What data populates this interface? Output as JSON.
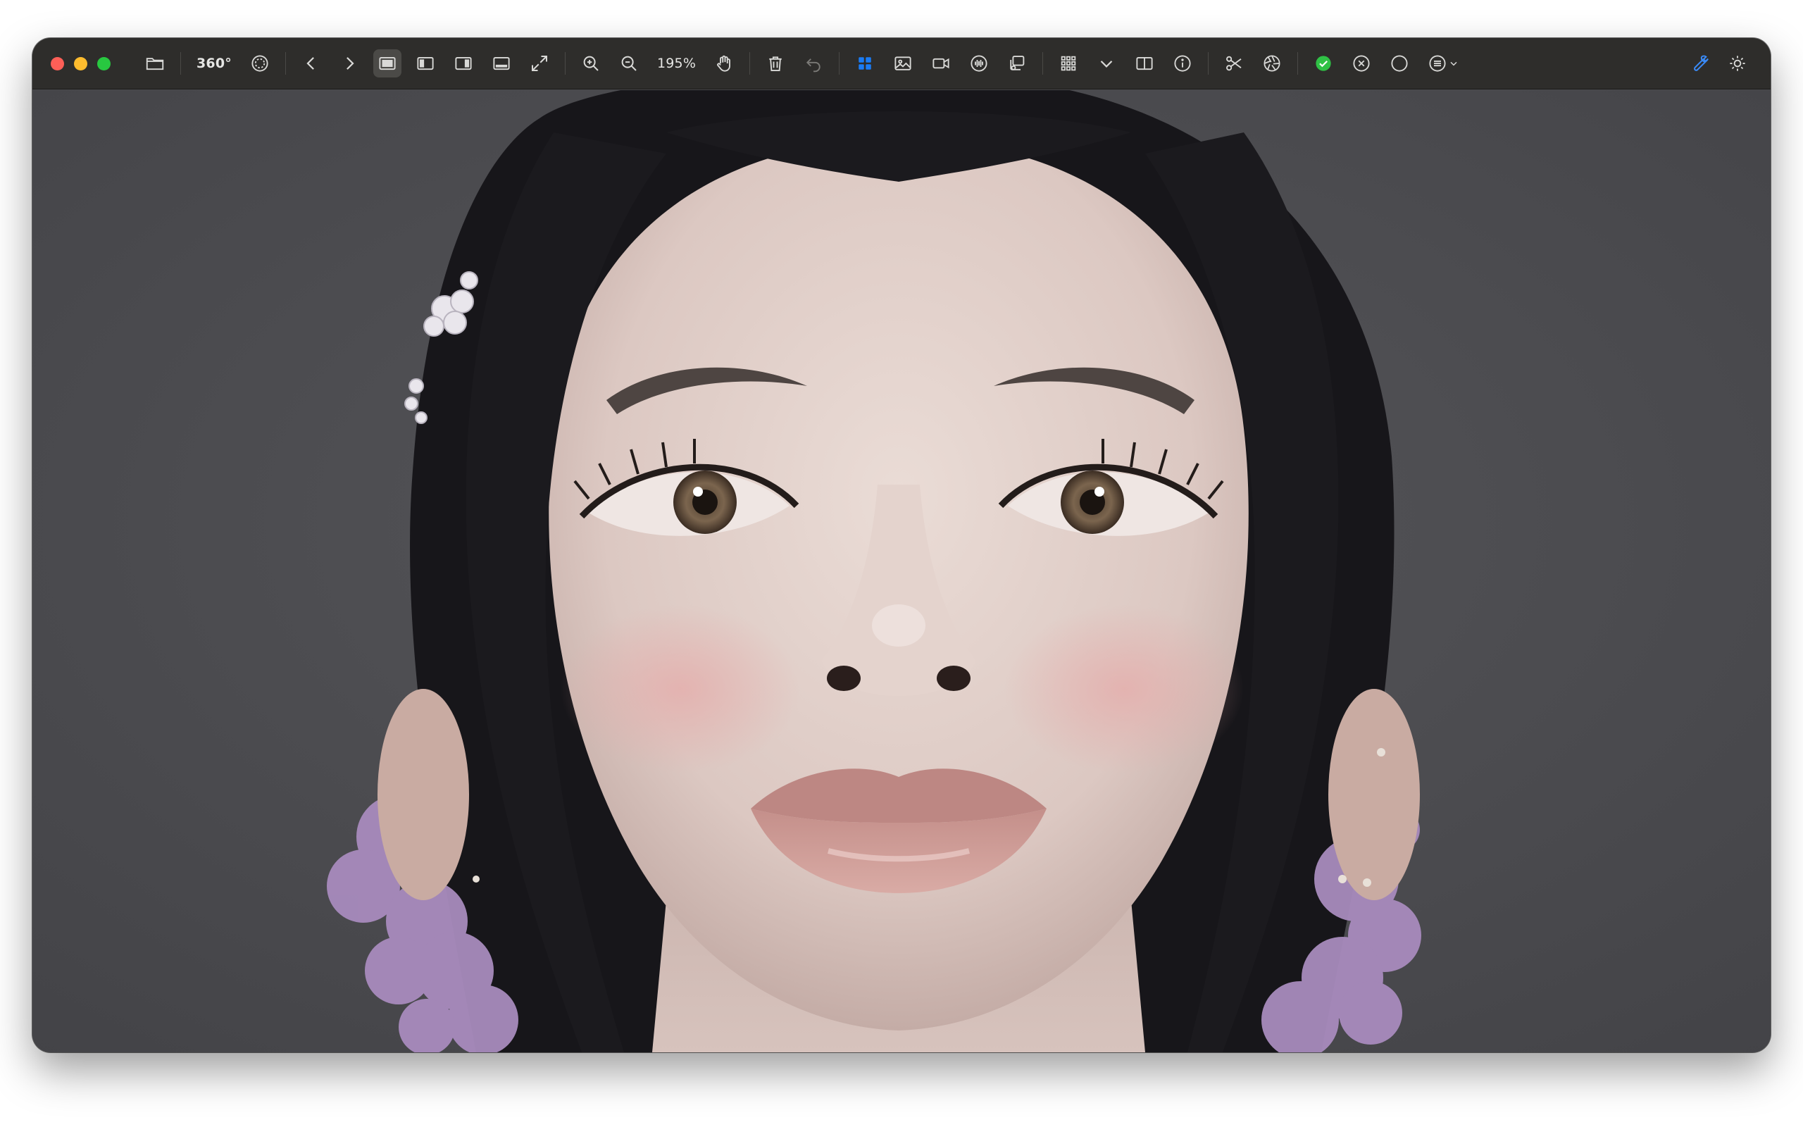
{
  "toolbar": {
    "rotation_label": "360°",
    "zoom_level": "195%"
  },
  "colors": {
    "toolbar_bg": "#2e2d2b",
    "accent_blue": "#1a7cf5",
    "check_green": "#2fc145",
    "photo_background": "#4a4a4d"
  },
  "image": {
    "subject_icon": "portrait-photo"
  }
}
